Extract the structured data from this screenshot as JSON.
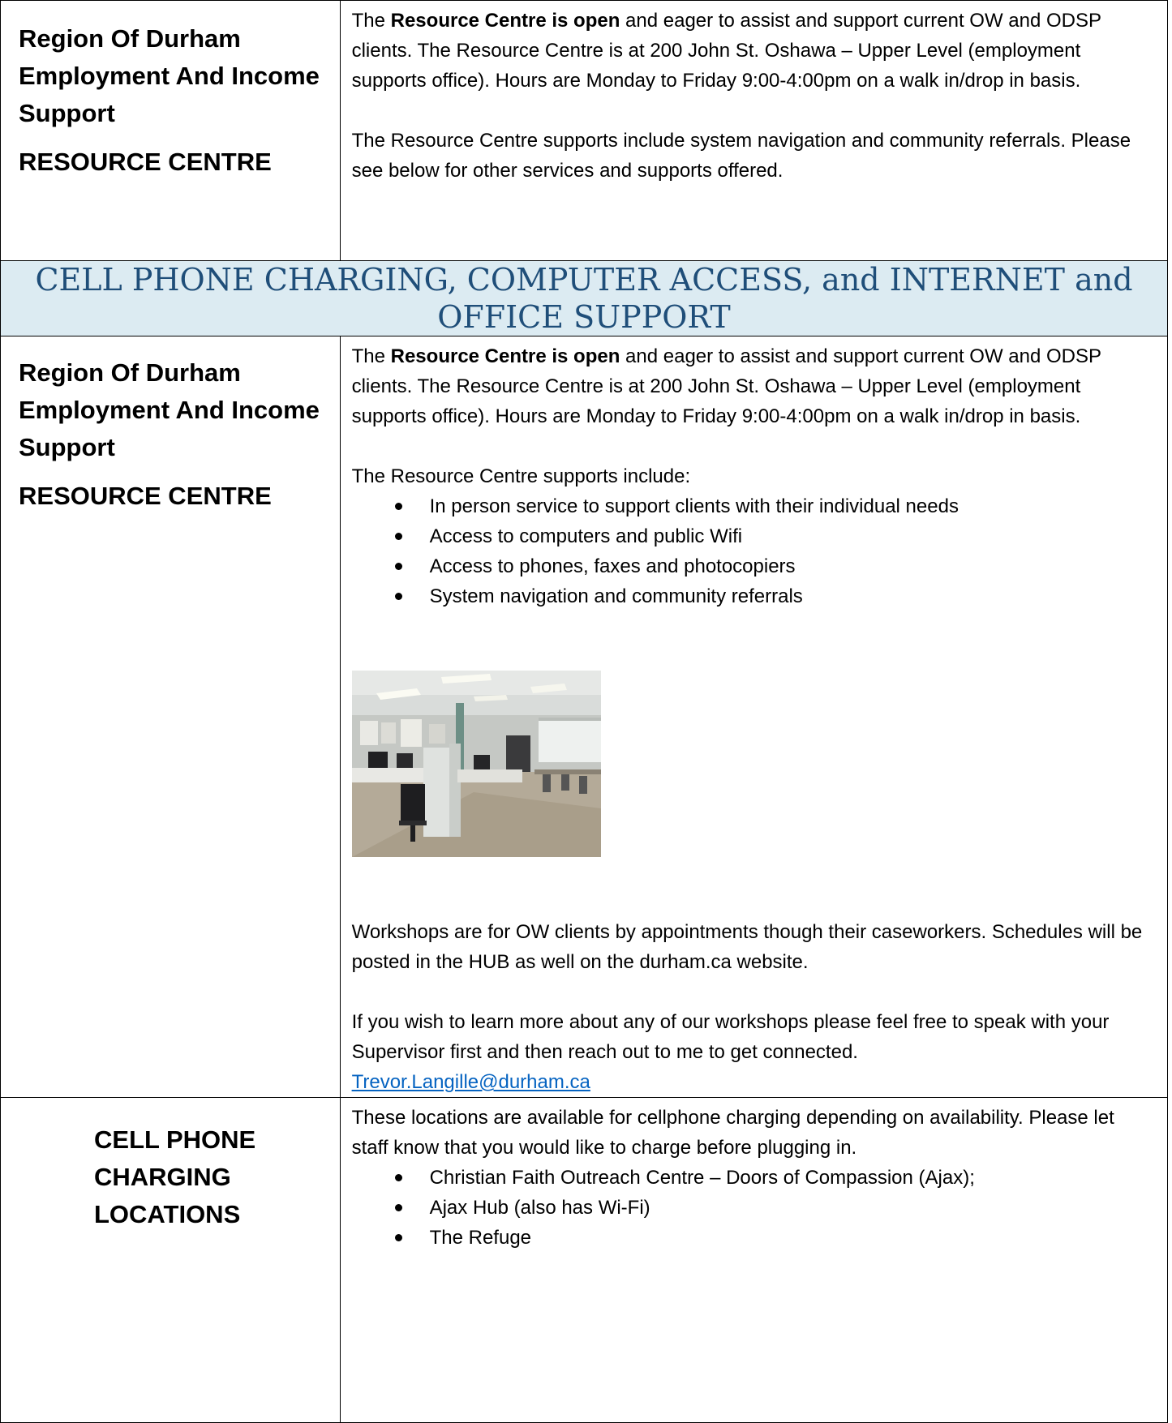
{
  "section1": {
    "left_title": "Region Of Durham Employment And Income Support",
    "left_subtitle": "RESOURCE CENTRE",
    "para1_prefix": "The ",
    "para1_bold": "Resource Centre is open",
    "para1_rest": " and eager to assist and support current OW and ODSP clients.  The Resource Centre is at 200 John St. Oshawa – Upper Level (employment supports office). Hours are Monday to Friday 9:00-4:00pm on a walk in/drop in basis.",
    "para2": "The Resource Centre supports include system navigation and community referrals. Please see below for other services and supports offered."
  },
  "banner": {
    "title": "CELL PHONE CHARGING, COMPUTER ACCESS, and INTERNET and OFFICE SUPPORT"
  },
  "section2": {
    "left_title": "Region Of Durham Employment And Income Support",
    "left_subtitle": "RESOURCE CENTRE",
    "para1_prefix": "The ",
    "para1_bold": "Resource Centre is open",
    "para1_rest": " and eager to assist and support current OW and ODSP clients.  The Resource Centre is at 200 John St. Oshawa – Upper Level (employment supports office). Hours are Monday to Friday 9:00-4:00pm on a walk in/drop in basis.",
    "supports_intro": "The Resource Centre supports include:",
    "supports": [
      "In person service to support clients with their individual needs",
      "Access to computers and public Wifi",
      "Access to phones, faxes and photocopiers",
      "System navigation and community referrals"
    ],
    "workshops_text": "Workshops are for OW clients by appointments though their caseworkers. Schedules  will be posted in the HUB as well on the durham.ca website.",
    "contact_text": "If you wish to learn more about any of our workshops please feel free to speak with your Supervisor first and then reach out to me to get connected.",
    "contact_email": "Trevor.Langille@durham.ca"
  },
  "section3": {
    "left_title": "CELL PHONE CHARGING LOCATIONS",
    "intro": "These locations are available for cellphone charging depending on availability. Please let staff know that you would like to charge before plugging in.",
    "locations": [
      "Christian Faith Outreach Centre – Doors of Compassion (Ajax);",
      "Ajax Hub (also has Wi-Fi)",
      "The Refuge"
    ]
  }
}
